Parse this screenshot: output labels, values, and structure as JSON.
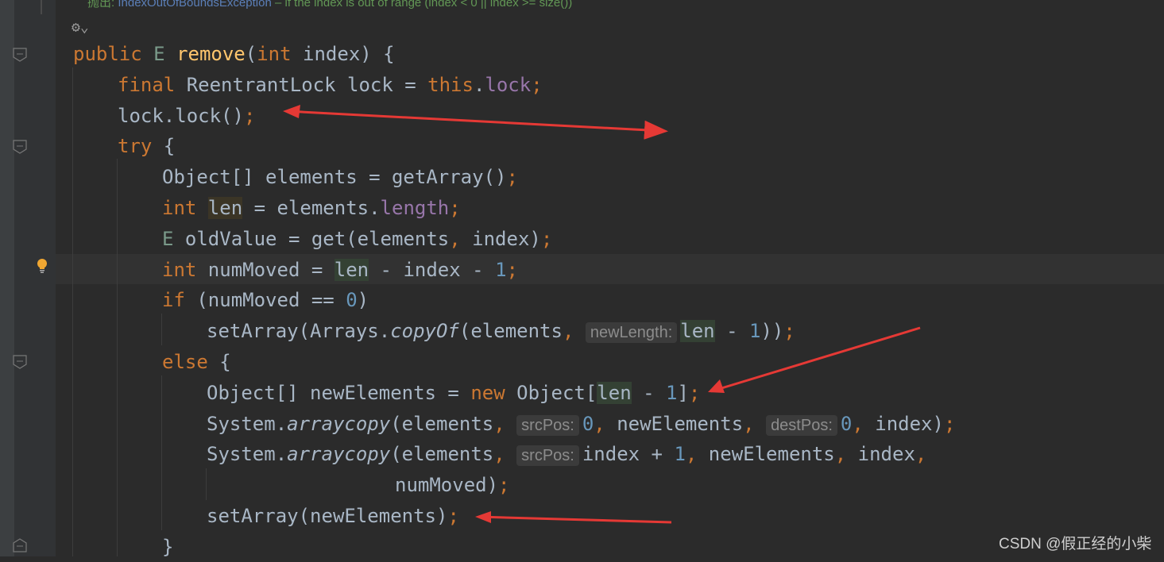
{
  "javadoc": {
    "prefix": "抛出: ",
    "exception": "IndexOutOfBoundsException",
    "text": " – if the index is out of range (index < 0 || index >= size())"
  },
  "watermark": "CSDN @假正经的小柴",
  "arrow_color": "#e53935",
  "lines": [
    [
      [
        "public ",
        "kw"
      ],
      [
        "E ",
        "tp"
      ],
      [
        "remove",
        "fn"
      ],
      [
        "(",
        ""
      ],
      [
        "int ",
        "kw"
      ],
      [
        "index) {",
        ""
      ]
    ],
    [
      [
        "final ",
        "kw"
      ],
      [
        "ReentrantLock lock = ",
        ""
      ],
      [
        "this",
        "kw"
      ],
      [
        ".",
        ""
      ],
      [
        "lock",
        "fld"
      ],
      [
        ";",
        "kw"
      ]
    ],
    [
      [
        "lock.lock()",
        ""
      ],
      [
        ";",
        "kw"
      ]
    ],
    [
      [
        "try ",
        "kw"
      ],
      [
        "{",
        ""
      ]
    ],
    [
      [
        "Object[] elements = getArray()",
        ""
      ],
      [
        ";",
        "kw"
      ]
    ],
    [
      [
        "int ",
        "kw"
      ],
      [
        "len",
        "hl2"
      ],
      [
        " = elements.",
        ""
      ],
      [
        "length",
        "fld"
      ],
      [
        ";",
        "kw"
      ]
    ],
    [
      [
        "E ",
        "tp"
      ],
      [
        "oldValue = get(elements",
        ""
      ],
      [
        ", ",
        "kw"
      ],
      [
        "index)",
        ""
      ],
      [
        ";",
        "kw"
      ]
    ],
    [
      [
        "int ",
        "kw"
      ],
      [
        "numMoved = ",
        ""
      ],
      [
        "len",
        "hl"
      ],
      [
        " - index - ",
        ""
      ],
      [
        "1",
        "num"
      ],
      [
        ";",
        "kw"
      ]
    ],
    [
      [
        "if ",
        "kw"
      ],
      [
        "(numMoved == ",
        ""
      ],
      [
        "0",
        "num"
      ],
      [
        ")",
        ""
      ]
    ],
    [
      [
        "setArray(Arrays.",
        ""
      ],
      [
        "copyOf",
        "it"
      ],
      [
        "(elements",
        ""
      ],
      [
        ", ",
        "kw"
      ],
      [
        "newLength:",
        "hint"
      ],
      [
        "len",
        "hl"
      ],
      [
        " - ",
        ""
      ],
      [
        "1",
        "num"
      ],
      [
        "))",
        ""
      ],
      [
        ";",
        "kw"
      ]
    ],
    [
      [
        "else ",
        "kw"
      ],
      [
        "{",
        ""
      ]
    ],
    [
      [
        "Object[] newElements = ",
        ""
      ],
      [
        "new ",
        "kw"
      ],
      [
        "Object[",
        ""
      ],
      [
        "len",
        "hl"
      ],
      [
        " - ",
        ""
      ],
      [
        "1",
        "num"
      ],
      [
        "]",
        ""
      ],
      [
        ";",
        "kw"
      ]
    ],
    [
      [
        "System.",
        ""
      ],
      [
        "arraycopy",
        "it"
      ],
      [
        "(elements",
        ""
      ],
      [
        ", ",
        "kw"
      ],
      [
        "srcPos:",
        "hint"
      ],
      [
        "0",
        "num"
      ],
      [
        ", ",
        "kw"
      ],
      [
        "newElements",
        ""
      ],
      [
        ", ",
        "kw"
      ],
      [
        "destPos:",
        "hint"
      ],
      [
        "0",
        "num"
      ],
      [
        ", ",
        "kw"
      ],
      [
        "index)",
        ""
      ],
      [
        ";",
        "kw"
      ]
    ],
    [
      [
        "System.",
        ""
      ],
      [
        "arraycopy",
        "it"
      ],
      [
        "(elements",
        ""
      ],
      [
        ", ",
        "kw"
      ],
      [
        "srcPos:",
        "hint"
      ],
      [
        "index + ",
        ""
      ],
      [
        "1",
        "num"
      ],
      [
        ", ",
        "kw"
      ],
      [
        "newElements",
        ""
      ],
      [
        ", ",
        "kw"
      ],
      [
        "index",
        ""
      ],
      [
        ",",
        "kw"
      ]
    ],
    [
      [
        "numMoved)",
        ""
      ],
      [
        ";",
        "kw"
      ]
    ],
    [
      [
        "setArray(newElements)",
        ""
      ],
      [
        ";",
        "kw"
      ]
    ],
    [
      [
        "}",
        ""
      ]
    ]
  ]
}
